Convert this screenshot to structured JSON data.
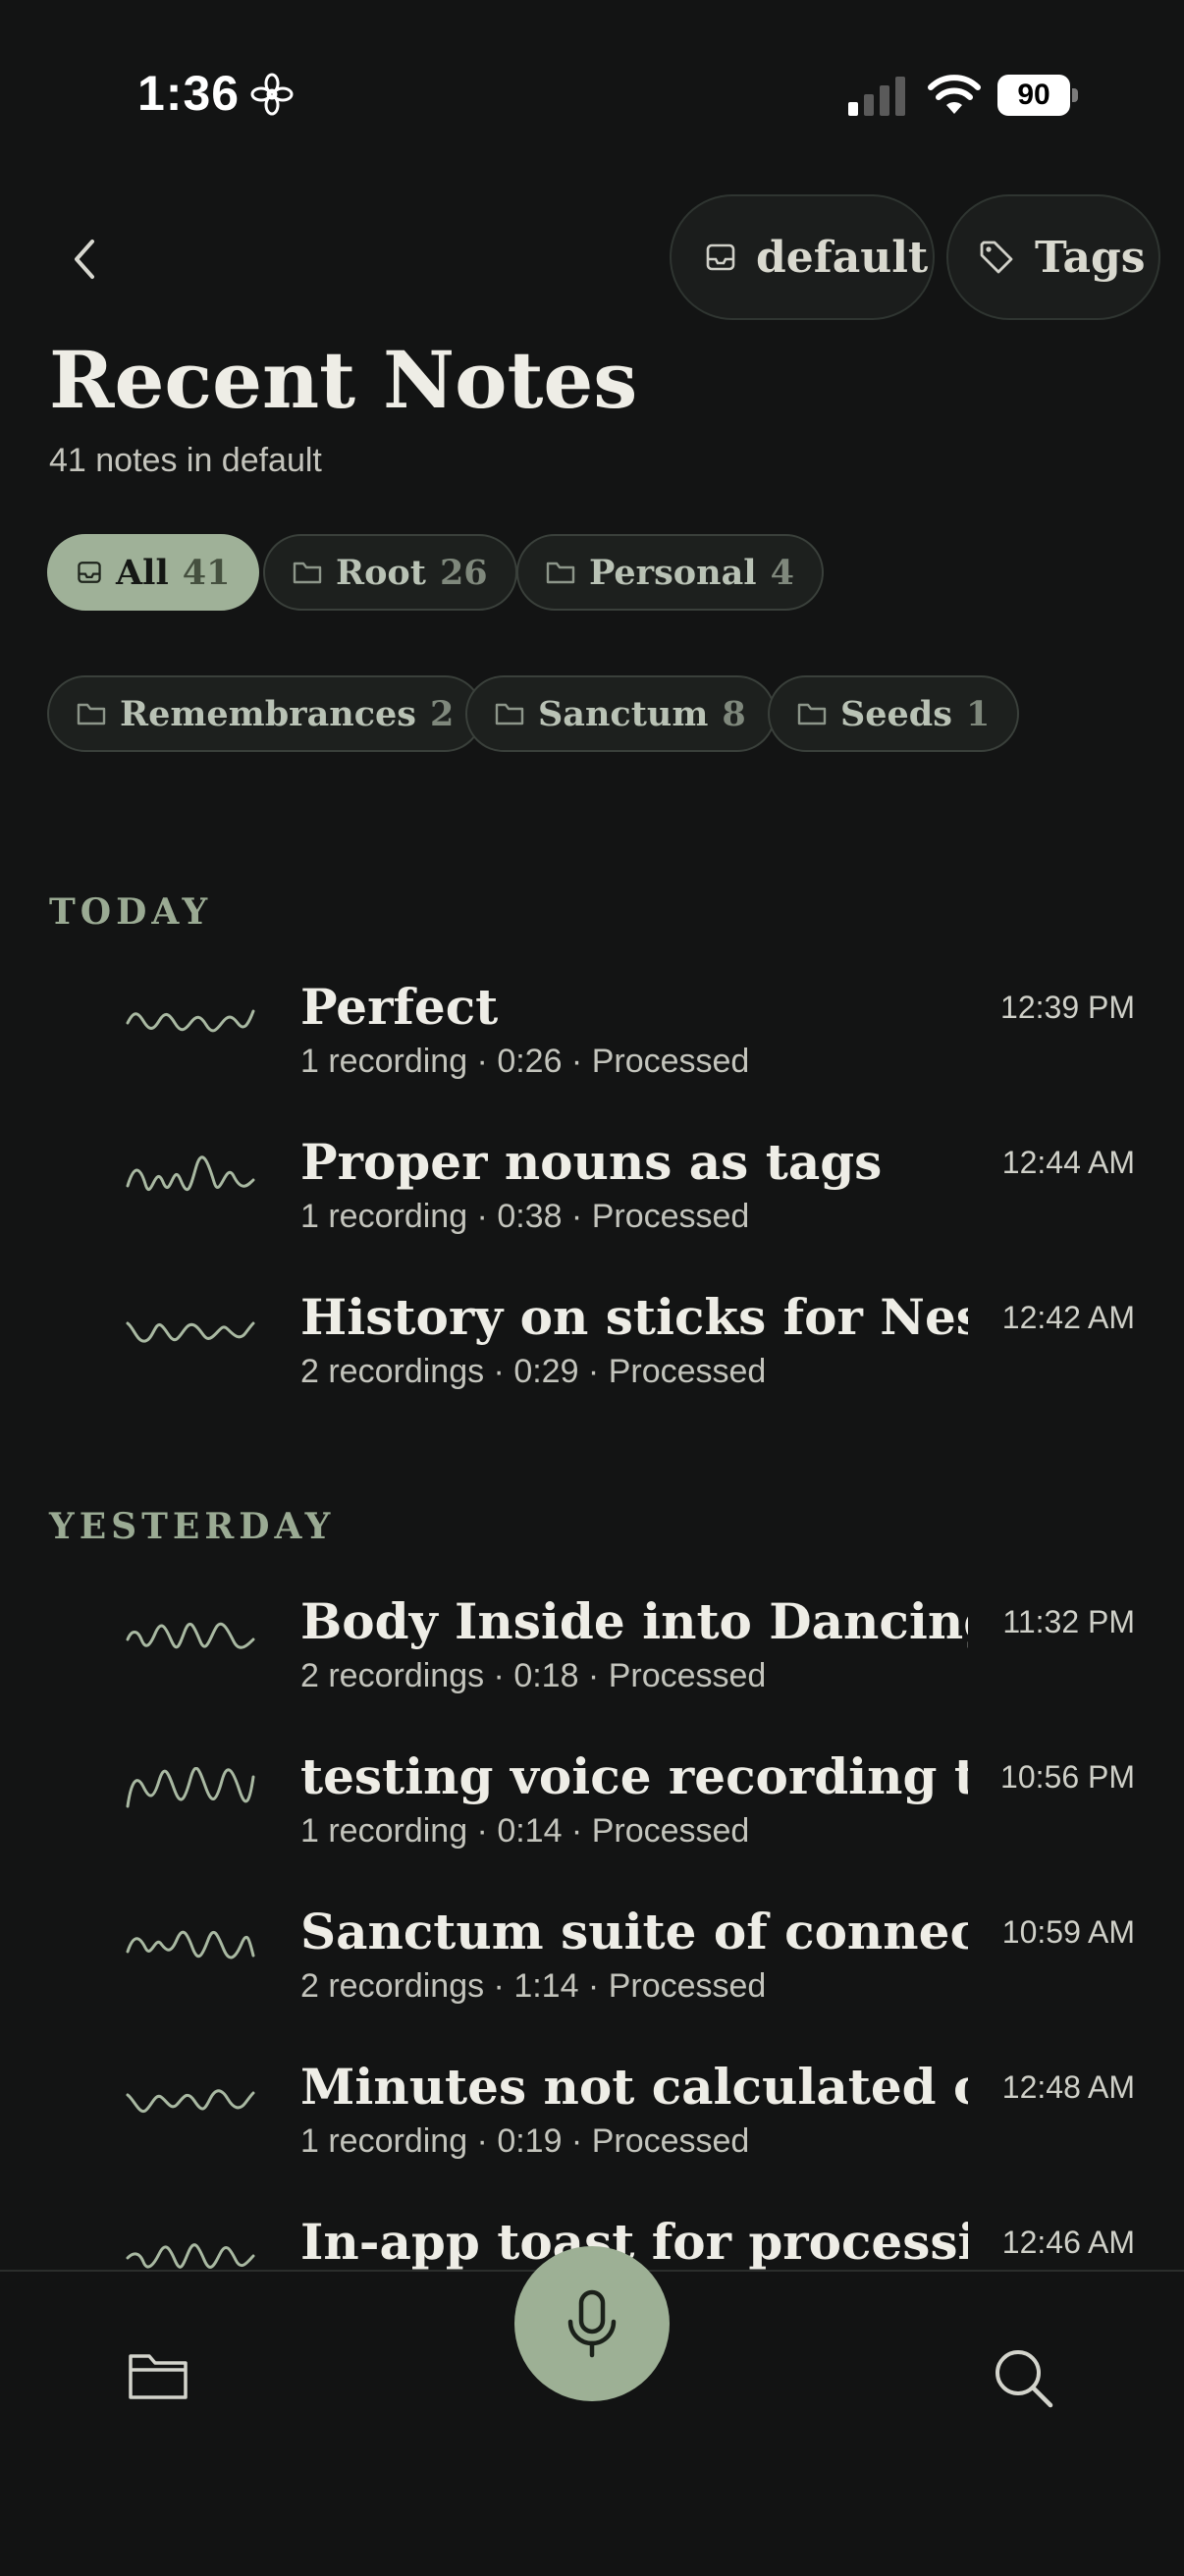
{
  "status_bar": {
    "time": "1:36",
    "battery": "90",
    "flower_icon": "flower-icon",
    "signal_icon": "signal-icon",
    "wifi_icon": "wifi-icon"
  },
  "header": {
    "back_icon": "chevron-left-icon",
    "inbox_button": {
      "icon": "inbox-icon",
      "label": "default"
    },
    "tags_button": {
      "icon": "tag-icon",
      "label": "Tags"
    },
    "title": "Recent Notes",
    "subtitle": "41 notes in default"
  },
  "filters": [
    {
      "label": "All",
      "count": "41",
      "icon": "inbox-icon",
      "active": true
    },
    {
      "label": "Root",
      "count": "26",
      "icon": "folder-icon",
      "active": false
    },
    {
      "label": "Personal",
      "count": "4",
      "icon": "folder-icon",
      "active": false
    },
    {
      "label": "Remembrances",
      "count": "2",
      "icon": "folder-icon",
      "active": false
    },
    {
      "label": "Sanctum",
      "count": "8",
      "icon": "folder-icon",
      "active": false
    },
    {
      "label": "Seeds",
      "count": "1",
      "icon": "folder-icon",
      "active": false
    }
  ],
  "sections": [
    {
      "label": "TODAY",
      "notes": [
        {
          "title": "Perfect",
          "meta": "1 recording · 0:26 · Processed",
          "time": "12:39 PM"
        },
        {
          "title": "Proper nouns as tags",
          "meta": "1 recording · 0:38 · Processed",
          "time": "12:44 AM"
        },
        {
          "title": "History on sticks for Nes...",
          "meta": "2 recordings · 0:29 · Processed",
          "time": "12:42 AM"
        }
      ]
    },
    {
      "label": "YESTERDAY",
      "notes": [
        {
          "title": "Body Inside into Dancing",
          "meta": "2 recordings · 0:18 · Processed",
          "time": "11:32 PM"
        },
        {
          "title": "testing voice recording tr...",
          "meta": "1 recording · 0:14 · Processed",
          "time": "10:56 PM"
        },
        {
          "title": "Sanctum suite of connec...",
          "meta": "2 recordings · 1:14 · Processed",
          "time": "10:59 AM"
        },
        {
          "title": "Minutes not calculated o...",
          "meta": "1 recording · 0:19 · Processed",
          "time": "12:48 AM"
        },
        {
          "title": "In-app toast for processi...",
          "meta": "",
          "time": "12:46 AM"
        }
      ]
    }
  ],
  "bottom_bar": {
    "folder_icon": "folder-icon",
    "mic_icon": "microphone-icon",
    "search_icon": "search-icon"
  },
  "colors": {
    "background": "#131414",
    "accent": "#9db095",
    "waveform": "#a9b9a2"
  }
}
